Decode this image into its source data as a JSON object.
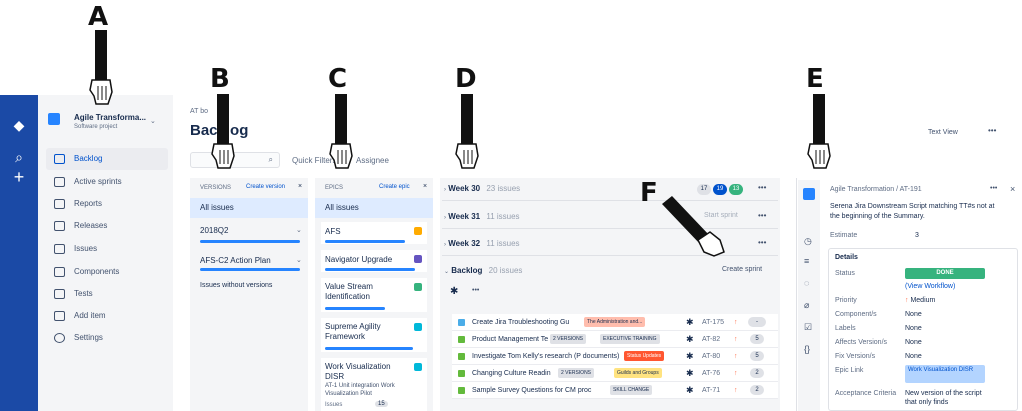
{
  "callouts": [
    "A",
    "B",
    "C",
    "D",
    "E",
    "F"
  ],
  "project": {
    "name": "Agile Transforma...",
    "type": "Software project"
  },
  "sidebar": {
    "items": [
      {
        "label": "Backlog",
        "icon": "backlog-icon"
      },
      {
        "label": "Active sprints",
        "icon": "board-icon"
      },
      {
        "label": "Reports",
        "icon": "chart-icon"
      },
      {
        "label": "Releases",
        "icon": "ship-icon"
      },
      {
        "label": "Issues",
        "icon": "issues-icon"
      },
      {
        "label": "Components",
        "icon": "components-icon"
      },
      {
        "label": "Tests",
        "icon": "tests-icon"
      },
      {
        "label": "Add item",
        "icon": "add-item-icon"
      },
      {
        "label": "Settings",
        "icon": "gear-icon"
      }
    ]
  },
  "header": {
    "breadcrumb": "AT bo",
    "title": "Backlog",
    "view_button": "Text View",
    "more": "•••"
  },
  "filters": {
    "quick_filters": "Quick Filters",
    "assignee": "Assignee"
  },
  "versions": {
    "header": "VERSIONS",
    "create": "Create version",
    "all": "All issues",
    "items": [
      "2018Q2",
      "AFS-C2 Action Plan"
    ],
    "without": "Issues without versions"
  },
  "epics": {
    "header": "EPICS",
    "create": "Create epic",
    "all": "All issues",
    "items": [
      "AFS",
      "Navigator Upgrade",
      "Value Stream Identification",
      "Supreme Agility Framework",
      "Work Visualization DISR"
    ],
    "subtext": "AT-1 Unit integration Work Visualization Pilot",
    "issues_label": "Issues",
    "issues_count": "15"
  },
  "sprints": [
    {
      "name": "Week 30",
      "count": "23 issues"
    },
    {
      "name": "Week 31",
      "count": "11 issues"
    },
    {
      "name": "Week 32",
      "count": "11 issues"
    },
    {
      "name": "Backlog",
      "count": "20 issues"
    }
  ],
  "week30_badges": [
    "17",
    "19",
    "13"
  ],
  "start_sprint": "Start sprint",
  "create_sprint": "Create sprint",
  "issues": [
    {
      "summary": "Create Jira Troubleshooting Gu",
      "chip": "The Administration and...",
      "chip_color": "#ffbdad",
      "key": "AT-175",
      "points": "-"
    },
    {
      "summary": "Product Management Te",
      "chip": "EXECUTIVE TRAINING",
      "chip_color": "#dfe1e6",
      "ver": "2 VERSIONS",
      "key": "AT-82",
      "points": "5"
    },
    {
      "summary": "Investigate Tom Kelly's research (P documents)",
      "chip": "Status Updates",
      "chip_color": "#ff5630",
      "key": "AT-80",
      "points": "5"
    },
    {
      "summary": "Changing Culture Readin",
      "chip": "Guilds and Groups",
      "chip_color": "#ffe380",
      "ver": "2 VERSIONS",
      "key": "AT-76",
      "points": "2"
    },
    {
      "summary": "Sample Survey Questions for CM proc",
      "chip": "SKILL CHANGE",
      "chip_color": "#dfe1e6",
      "key": "AT-71",
      "points": "2"
    }
  ],
  "detail": {
    "breadcrumb": "Agile Transformation / AT-191",
    "summary": "Serena Jira Downstream Script matching TT#s not at the beginning of the Summary.",
    "estimate_label": "Estimate",
    "estimate_value": "3",
    "details_title": "Details",
    "status_label": "Status",
    "status_value": "DONE",
    "workflow_link": "(View Workflow)",
    "fields": [
      {
        "label": "Priority",
        "value": "Medium"
      },
      {
        "label": "Component/s",
        "value": "None"
      },
      {
        "label": "Labels",
        "value": "None"
      },
      {
        "label": "Affects Version/s",
        "value": "None"
      },
      {
        "label": "Fix Version/s",
        "value": "None"
      },
      {
        "label": "Epic Link",
        "value": "Work Visualization DISR"
      },
      {
        "label": "Acceptance Criteria",
        "value": "New version of the script that only finds"
      }
    ]
  },
  "colors": {
    "nav": "#1b4aa6",
    "accent": "#0052cc",
    "done": "#36b37e"
  }
}
